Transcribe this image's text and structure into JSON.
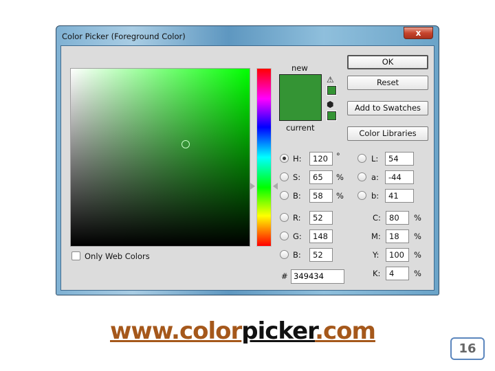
{
  "window": {
    "title": "Color Picker (Foreground Color)",
    "close_label": "x"
  },
  "preview": {
    "new_label": "new",
    "current_label": "current",
    "new_color": "#349434",
    "current_color": "#349434"
  },
  "buttons": {
    "ok": "OK",
    "reset": "Reset",
    "add_to_swatches": "Add to Swatches",
    "color_libraries": "Color Libraries"
  },
  "hsb": [
    {
      "label": "H:",
      "value": "120",
      "unit": "°",
      "selected": true
    },
    {
      "label": "S:",
      "value": "65",
      "unit": "%",
      "selected": false
    },
    {
      "label": "B:",
      "value": "58",
      "unit": "%",
      "selected": false
    }
  ],
  "rgb": [
    {
      "label": "R:",
      "value": "52"
    },
    {
      "label": "G:",
      "value": "148"
    },
    {
      "label": "B:",
      "value": "52"
    }
  ],
  "lab": [
    {
      "label": "L:",
      "value": "54"
    },
    {
      "label": "a:",
      "value": "-44"
    },
    {
      "label": "b:",
      "value": "41"
    }
  ],
  "cmyk": [
    {
      "label": "C:",
      "value": "80",
      "unit": "%"
    },
    {
      "label": "M:",
      "value": "18",
      "unit": "%"
    },
    {
      "label": "Y:",
      "value": "100",
      "unit": "%"
    },
    {
      "label": "K:",
      "value": "4",
      "unit": "%"
    }
  ],
  "hex": {
    "label": "#",
    "value": "349434"
  },
  "only_web_colors": {
    "label": "Only Web Colors",
    "checked": false
  },
  "footer": {
    "url_part1": "www.color",
    "url_part2": "picker",
    "url_part3": ".com",
    "page_number": "16"
  }
}
